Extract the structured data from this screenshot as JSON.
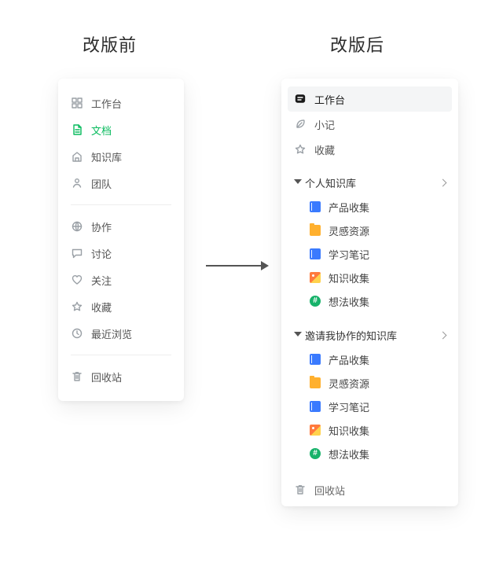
{
  "headings": {
    "before": "改版前",
    "after": "改版后"
  },
  "before": {
    "group1": [
      "工作台",
      "文档",
      "知识库",
      "团队"
    ],
    "group2": [
      "协作",
      "讨论",
      "关注",
      "收藏",
      "最近浏览"
    ],
    "trash": "回收站"
  },
  "after": {
    "top": [
      "工作台",
      "小记",
      "收藏"
    ],
    "sections": [
      {
        "title": "个人知识库",
        "items": [
          "产品收集",
          "灵感资源",
          "学习笔记",
          "知识收集",
          "想法收集"
        ]
      },
      {
        "title": "邀请我协作的知识库",
        "items": [
          "产品收集",
          "灵感资源",
          "学习笔记",
          "知识收集",
          "想法收集"
        ]
      }
    ],
    "trash": "回收站"
  }
}
